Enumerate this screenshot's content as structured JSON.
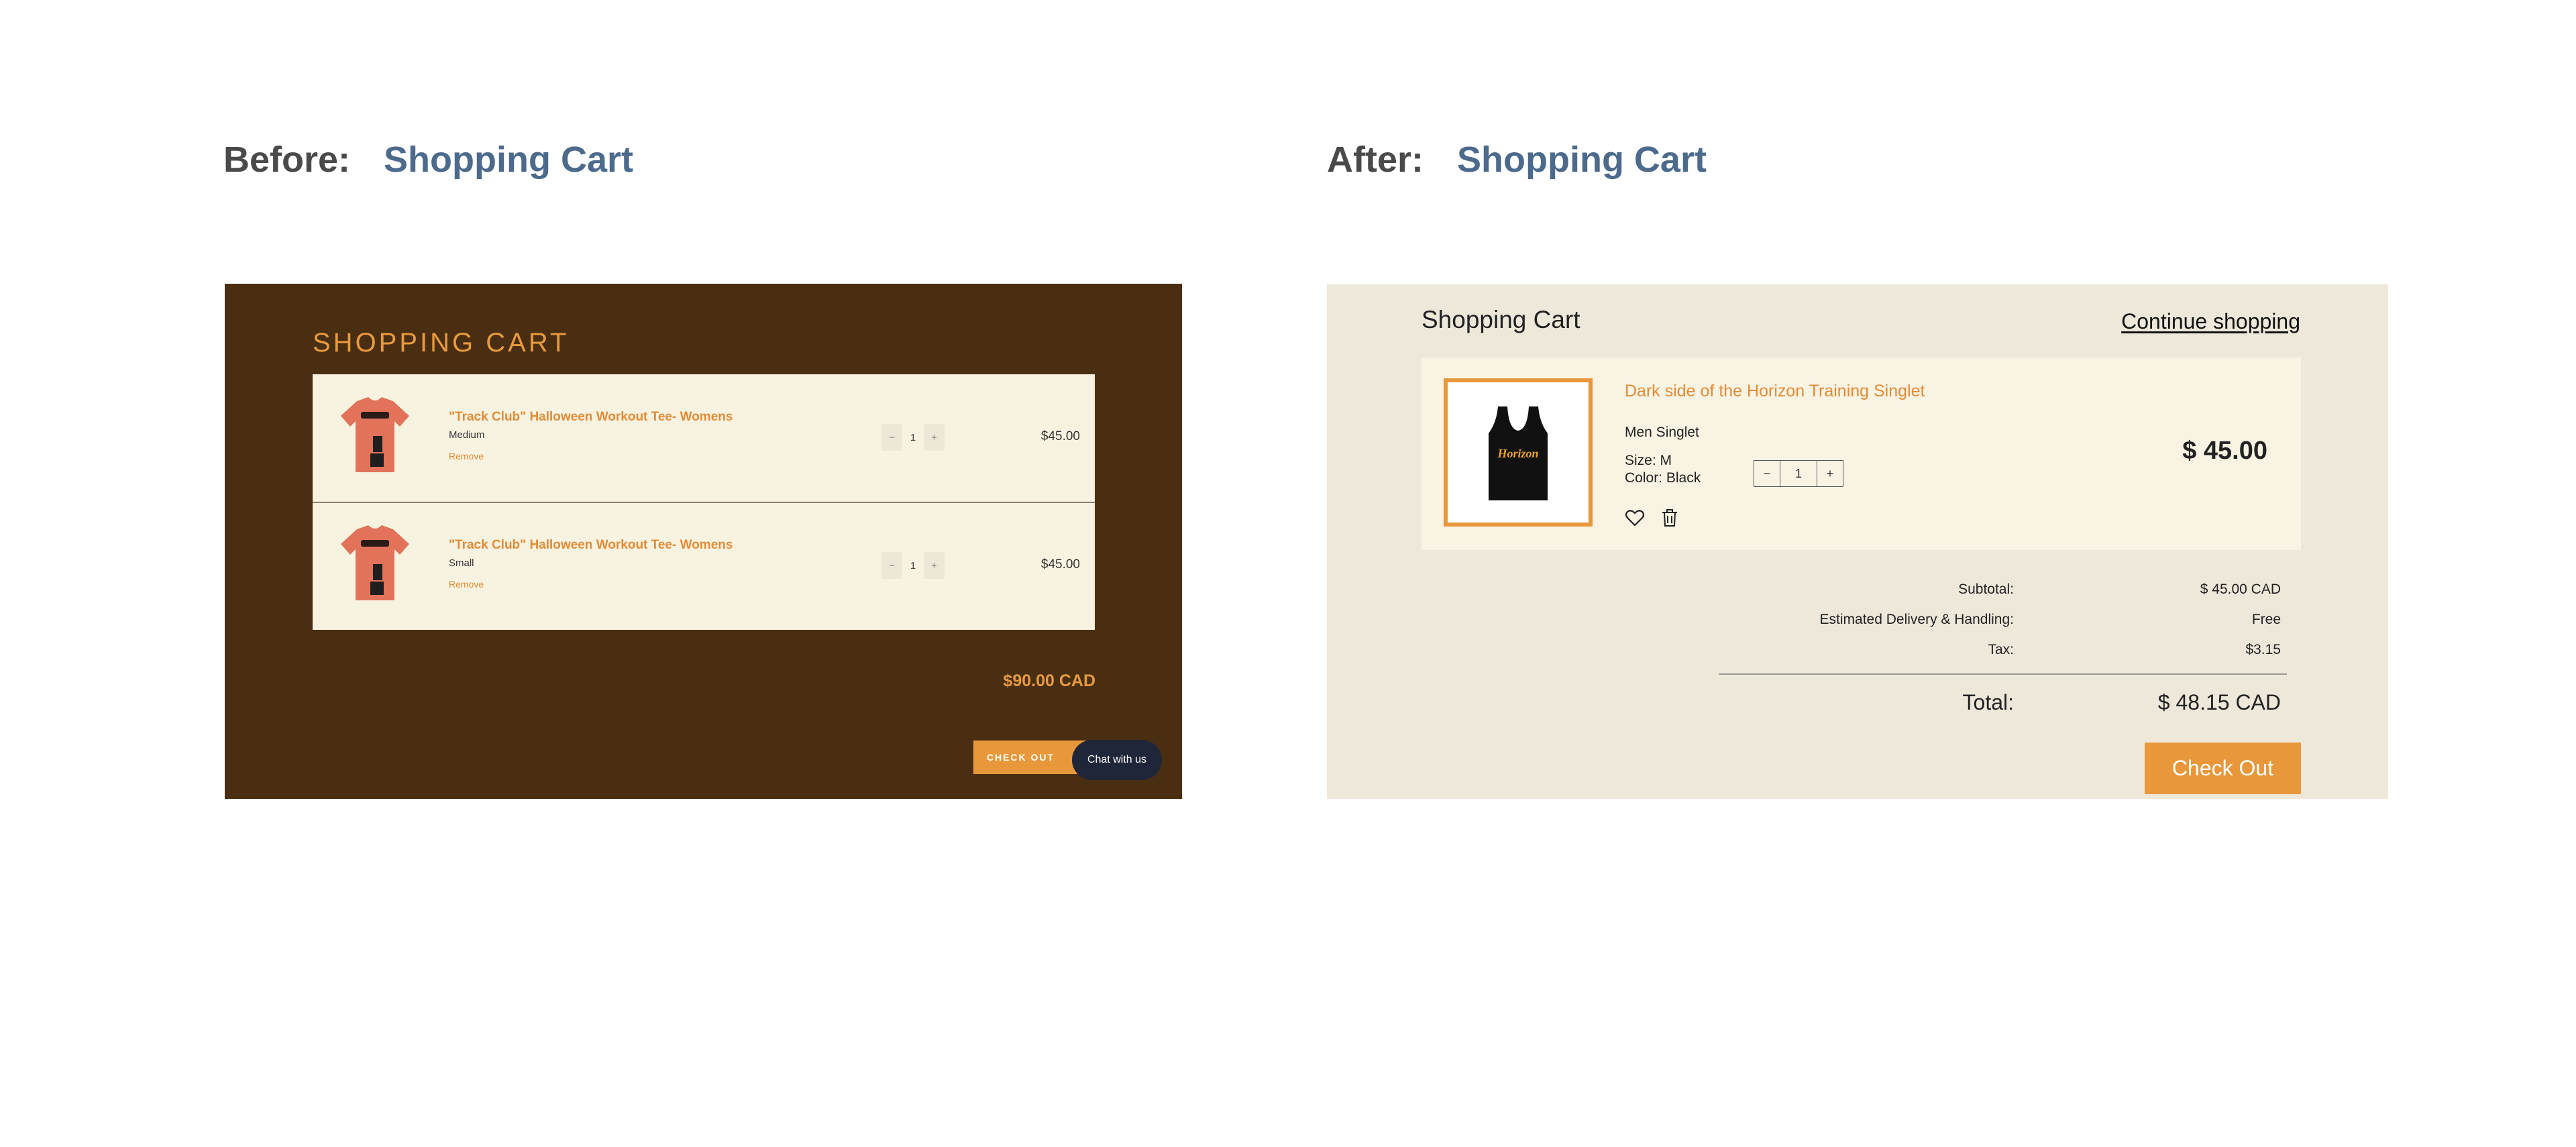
{
  "before": {
    "label": "Before:",
    "title": "Shopping Cart",
    "cart_title": "SHOPPING CART",
    "items": [
      {
        "name": "\"Track Club\" Halloween Workout Tee- Womens",
        "size": "Medium",
        "remove": "Remove",
        "qty": "1",
        "price": "$45.00"
      },
      {
        "name": "\"Track Club\" Halloween Workout Tee- Womens",
        "size": "Small",
        "remove": "Remove",
        "qty": "1",
        "price": "$45.00"
      }
    ],
    "minus": "−",
    "plus": "+",
    "total": "$90.00 CAD",
    "checkout": "CHECK OUT",
    "chat": "Chat with us",
    "colors": {
      "panel_bg": "#4a2e12",
      "accent": "#e89a3e",
      "list_bg": "#f8f3e1"
    }
  },
  "after": {
    "label": "After:",
    "title": "Shopping Cart",
    "cart_title": "Shopping Cart",
    "continue": "Continue shopping",
    "item": {
      "name": "Dark side of the Horizon Training Singlet",
      "type": "Men Singlet",
      "size": "Size: M",
      "color": "Color: Black",
      "qty": "1",
      "price": "$ 45.00",
      "shirt_text": "Horizon"
    },
    "minus": "−",
    "plus": "+",
    "summary": [
      {
        "label": "Subtotal:",
        "value": "$ 45.00 CAD"
      },
      {
        "label": "Estimated Delivery & Handling:",
        "value": "Free"
      },
      {
        "label": "Tax:",
        "value": "$3.15"
      }
    ],
    "total_label": "Total:",
    "total_value": "$ 48.15 CAD",
    "checkout": "Check Out",
    "colors": {
      "panel_bg": "#eee8db",
      "accent": "#e8983a",
      "item_bg": "#f8f3e3"
    }
  }
}
